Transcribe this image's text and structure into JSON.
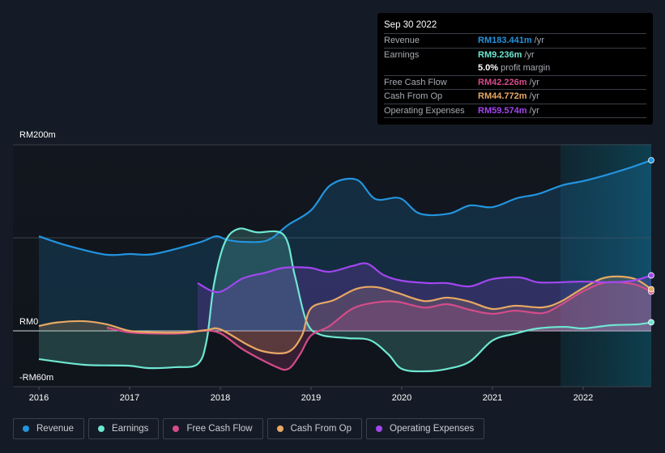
{
  "tooltip": {
    "date": "Sep 30 2022",
    "rows": [
      {
        "label": "Revenue",
        "value": "RM183.441m",
        "unit": "/yr",
        "color": "#2394df"
      },
      {
        "label": "Earnings",
        "value": "RM9.236m",
        "unit": "/yr",
        "color": "#6ee7d2"
      },
      {
        "label": "",
        "value": "5.0%",
        "unit": "profit margin",
        "color": "#ffffff"
      },
      {
        "label": "Free Cash Flow",
        "value": "RM42.226m",
        "unit": "/yr",
        "color": "#d44c8a"
      },
      {
        "label": "Cash From Op",
        "value": "RM44.772m",
        "unit": "/yr",
        "color": "#e8a864"
      },
      {
        "label": "Operating Expenses",
        "value": "RM59.574m",
        "unit": "/yr",
        "color": "#a346f0"
      }
    ]
  },
  "legend": [
    {
      "label": "Revenue",
      "color": "#2394df"
    },
    {
      "label": "Earnings",
      "color": "#6ee7d2"
    },
    {
      "label": "Free Cash Flow",
      "color": "#d44c8a"
    },
    {
      "label": "Cash From Op",
      "color": "#e8a864"
    },
    {
      "label": "Operating Expenses",
      "color": "#a346f0"
    }
  ],
  "chart_data": {
    "type": "area",
    "title": "",
    "xlabel": "",
    "ylabel": "",
    "y_tick_labels": [
      {
        "value": 200,
        "label": "RM200m"
      },
      {
        "value": 0,
        "label": "RM0"
      },
      {
        "value": -60,
        "label": "-RM60m"
      }
    ],
    "ylim": [
      -60,
      200
    ],
    "xlim": [
      2015.7,
      2022.75
    ],
    "x_ticks": [
      2016,
      2017,
      2018,
      2019,
      2020,
      2021,
      2022
    ],
    "x_tick_labels": [
      "2016",
      "2017",
      "2018",
      "2019",
      "2020",
      "2021",
      "2022"
    ],
    "gridlines_y": [
      200,
      100,
      0
    ],
    "highlight_start": 2021.75,
    "series": [
      {
        "name": "Revenue",
        "color": "#2394df",
        "points": [
          [
            2016.0,
            101.7
          ],
          [
            2016.3,
            92
          ],
          [
            2016.73,
            82
          ],
          [
            2017.0,
            82.6
          ],
          [
            2017.27,
            82.6
          ],
          [
            2017.76,
            94.8
          ],
          [
            2017.95,
            101.7
          ],
          [
            2018.07,
            98
          ],
          [
            2018.25,
            95.7
          ],
          [
            2018.52,
            97.4
          ],
          [
            2018.75,
            114
          ],
          [
            2019.0,
            129.6
          ],
          [
            2019.22,
            157
          ],
          [
            2019.5,
            162.6
          ],
          [
            2019.71,
            141.7
          ],
          [
            2019.98,
            142.6
          ],
          [
            2020.2,
            126
          ],
          [
            2020.52,
            126
          ],
          [
            2020.75,
            134.8
          ],
          [
            2021.0,
            133
          ],
          [
            2021.27,
            142.6
          ],
          [
            2021.5,
            147
          ],
          [
            2021.77,
            156.5
          ],
          [
            2022.0,
            161
          ],
          [
            2022.27,
            168
          ],
          [
            2022.55,
            176.5
          ],
          [
            2022.75,
            183.4
          ]
        ]
      },
      {
        "name": "Earnings",
        "color": "#6ee7d2",
        "points": [
          [
            2016.0,
            -30.4
          ],
          [
            2016.5,
            -36.5
          ],
          [
            2016.98,
            -37.4
          ],
          [
            2017.2,
            -40
          ],
          [
            2017.5,
            -39.1
          ],
          [
            2017.75,
            -35.7
          ],
          [
            2017.85,
            -10
          ],
          [
            2017.93,
            50
          ],
          [
            2018.05,
            95
          ],
          [
            2018.2,
            109.6
          ],
          [
            2018.4,
            106
          ],
          [
            2018.7,
            103
          ],
          [
            2018.82,
            60
          ],
          [
            2018.95,
            10
          ],
          [
            2019.1,
            -4
          ],
          [
            2019.4,
            -7.8
          ],
          [
            2019.65,
            -10
          ],
          [
            2019.85,
            -25
          ],
          [
            2020.0,
            -40.9
          ],
          [
            2020.25,
            -43.5
          ],
          [
            2020.5,
            -40.9
          ],
          [
            2020.75,
            -33
          ],
          [
            2021.0,
            -10.4
          ],
          [
            2021.25,
            -3
          ],
          [
            2021.5,
            2.6
          ],
          [
            2021.8,
            4.3
          ],
          [
            2022.0,
            2.6
          ],
          [
            2022.3,
            6
          ],
          [
            2022.6,
            7
          ],
          [
            2022.75,
            9.2
          ]
        ]
      },
      {
        "name": "Free Cash Flow",
        "color": "#d44c8a",
        "points": [
          [
            2016.75,
            3.5
          ],
          [
            2017.0,
            -1.7
          ],
          [
            2017.3,
            -3
          ],
          [
            2017.6,
            -2.6
          ],
          [
            2017.8,
            0
          ],
          [
            2018.0,
            -2.6
          ],
          [
            2018.25,
            -20
          ],
          [
            2018.6,
            -38
          ],
          [
            2018.75,
            -40.9
          ],
          [
            2018.88,
            -25
          ],
          [
            2019.0,
            -5
          ],
          [
            2019.2,
            5
          ],
          [
            2019.45,
            23.5
          ],
          [
            2019.7,
            30.4
          ],
          [
            2019.95,
            31.3
          ],
          [
            2020.25,
            25
          ],
          [
            2020.5,
            28.7
          ],
          [
            2020.75,
            22.6
          ],
          [
            2021.0,
            18.3
          ],
          [
            2021.25,
            21.7
          ],
          [
            2021.55,
            19.1
          ],
          [
            2021.75,
            27.8
          ],
          [
            2022.0,
            42.6
          ],
          [
            2022.25,
            52
          ],
          [
            2022.55,
            50.4
          ],
          [
            2022.75,
            42.2
          ]
        ]
      },
      {
        "name": "Cash From Op",
        "color": "#e8a864",
        "points": [
          [
            2016.0,
            5.2
          ],
          [
            2016.2,
            9
          ],
          [
            2016.5,
            10.4
          ],
          [
            2016.75,
            7
          ],
          [
            2017.0,
            0
          ],
          [
            2017.3,
            -1.7
          ],
          [
            2017.6,
            -1.7
          ],
          [
            2017.85,
            0.9
          ],
          [
            2018.0,
            1.7
          ],
          [
            2018.3,
            -15
          ],
          [
            2018.5,
            -22.6
          ],
          [
            2018.75,
            -22.6
          ],
          [
            2018.9,
            -5
          ],
          [
            2019.0,
            24.3
          ],
          [
            2019.25,
            33
          ],
          [
            2019.5,
            45.2
          ],
          [
            2019.72,
            47
          ],
          [
            2019.95,
            40.9
          ],
          [
            2020.25,
            32
          ],
          [
            2020.5,
            35.7
          ],
          [
            2020.75,
            31.3
          ],
          [
            2021.0,
            23.5
          ],
          [
            2021.25,
            27
          ],
          [
            2021.55,
            25.2
          ],
          [
            2021.75,
            31.3
          ],
          [
            2022.0,
            46
          ],
          [
            2022.25,
            57.4
          ],
          [
            2022.55,
            56.5
          ],
          [
            2022.75,
            44.8
          ]
        ]
      },
      {
        "name": "Operating Expenses",
        "color": "#a346f0",
        "points": [
          [
            2017.75,
            51.3
          ],
          [
            2017.98,
            41.7
          ],
          [
            2018.25,
            56.5
          ],
          [
            2018.5,
            62.6
          ],
          [
            2018.7,
            67.8
          ],
          [
            2018.98,
            67.8
          ],
          [
            2019.2,
            63.5
          ],
          [
            2019.45,
            69.6
          ],
          [
            2019.62,
            72.2
          ],
          [
            2019.8,
            60
          ],
          [
            2020.0,
            53.9
          ],
          [
            2020.3,
            51.3
          ],
          [
            2020.5,
            51.3
          ],
          [
            2020.75,
            47.8
          ],
          [
            2021.0,
            55.7
          ],
          [
            2021.3,
            57.4
          ],
          [
            2021.5,
            52.2
          ],
          [
            2021.75,
            52.2
          ],
          [
            2022.0,
            53
          ],
          [
            2022.3,
            52.2
          ],
          [
            2022.55,
            53.9
          ],
          [
            2022.75,
            59.6
          ]
        ]
      }
    ]
  }
}
